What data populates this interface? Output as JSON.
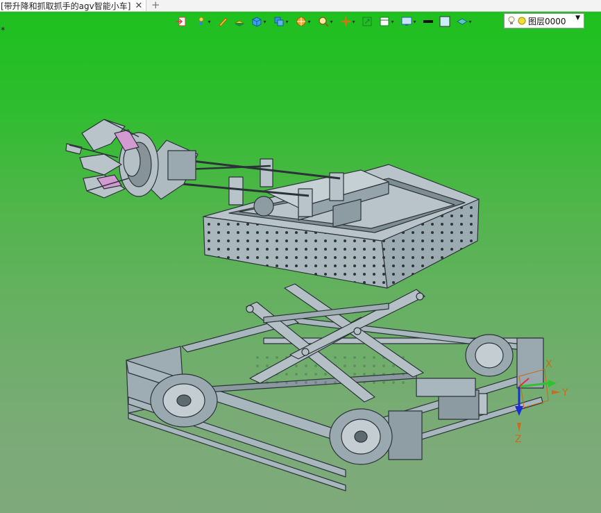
{
  "tab": {
    "title": "[带升降和抓取抓手的agv智能小车]",
    "close": "✕",
    "add": "+"
  },
  "toolbar": {
    "icons": [
      "exit-sketch-icon",
      "light-icon",
      "sketch-pen-icon",
      "extrude-icon",
      "solid-cube-icon",
      "multi-body-icon",
      "render-ball-icon",
      "zoom-icon",
      "pan-icon",
      "fit-view-icon",
      "view-orient-icon",
      "display-icon",
      "line-color-swatch",
      "fill-color-swatch",
      "material-icon"
    ],
    "layer": {
      "label": "图层0000"
    }
  },
  "axes": {
    "x": "X",
    "y": "Y",
    "z": "Z"
  },
  "colors": {
    "bg_top": "#1ec01e",
    "bg_bottom": "#7fa97b",
    "model": "#a8b6bd",
    "outline": "#2b3338",
    "accent_pink": "#d29ad0"
  }
}
